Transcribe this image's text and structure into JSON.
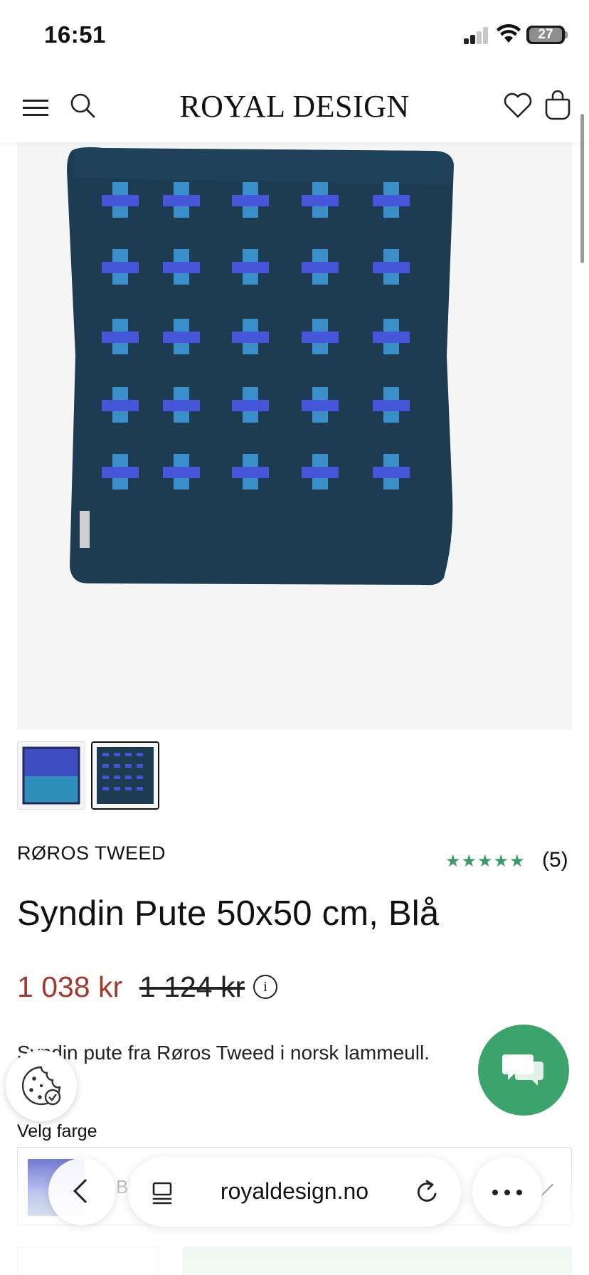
{
  "status_bar": {
    "time": "16:51",
    "battery": "27"
  },
  "header": {
    "logo": "ROYAL DESIGN"
  },
  "product": {
    "brand": "RØROS TWEED",
    "rating_stars": "★★★★★",
    "review_count": "(5)",
    "title": "Syndin Pute 50x50 cm, Blå",
    "price_current": "1 038 kr",
    "price_original": "1 124 kr",
    "info_label": "i",
    "description": "Syndin pute fra Røros Tweed i norsk lammeull.",
    "image_colors": {
      "background": "#f5f5f5",
      "pillow": "#1d3c52",
      "cross": "#4656d8",
      "cross_accent": "#3b8fc9"
    }
  },
  "color_selector": {
    "label": "Velg farge",
    "selected": "Blå"
  },
  "browser": {
    "url": "royaldesign.no"
  },
  "colors": {
    "price_sale": "#a13a2a",
    "rating": "#3a9a68",
    "chat": "#3da36d",
    "buy_button": "#d7eedf"
  }
}
